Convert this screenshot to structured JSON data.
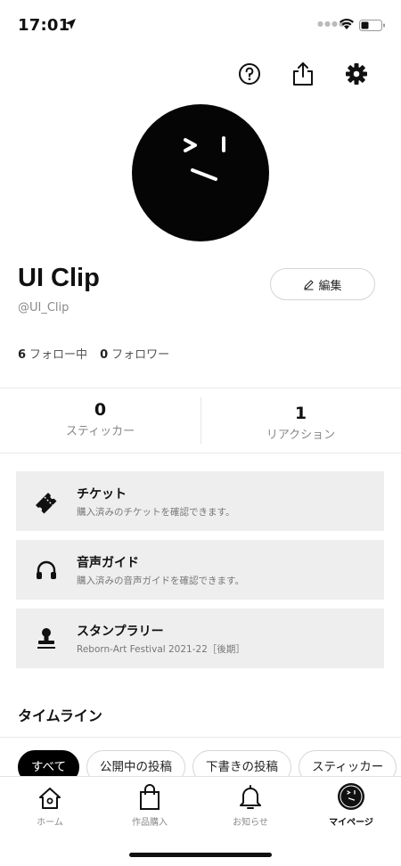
{
  "status_bar": {
    "time": "17:01"
  },
  "header": {
    "help_icon": "help-icon",
    "share_icon": "share-icon",
    "settings_icon": "gear-icon"
  },
  "profile": {
    "name": "UI Clip",
    "handle": "@UI_Clip",
    "edit_label": "編集",
    "following_count": "6",
    "following_label": "フォロー中",
    "followers_count": "0",
    "followers_label": "フォロワー"
  },
  "stats": [
    {
      "value": "0",
      "label": "スティッカー"
    },
    {
      "value": "1",
      "label": "リアクション"
    }
  ],
  "cards": [
    {
      "icon": "ticket-icon",
      "title": "チケット",
      "subtitle": "購入済みのチケットを確認できます。"
    },
    {
      "icon": "headphones-icon",
      "title": "音声ガイド",
      "subtitle": "購入済みの音声ガイドを確認できます。"
    },
    {
      "icon": "stamp-icon",
      "title": "スタンプラリー",
      "subtitle": "Reborn-Art Festival 2021-22［後期］"
    }
  ],
  "timeline": {
    "title": "タイムライン",
    "filters": [
      "すべて",
      "公開中の投稿",
      "下書きの投稿",
      "スティッカー"
    ],
    "active_filter": "すべて"
  },
  "tabs": [
    {
      "icon": "home-icon",
      "label": "ホーム"
    },
    {
      "icon": "shopping-bag-icon",
      "label": "作品購入"
    },
    {
      "icon": "bell-icon",
      "label": "お知らせ"
    },
    {
      "icon": "avatar-icon",
      "label": "マイページ"
    }
  ],
  "colors": {
    "card_bg": "#eeeeee",
    "accent": "#000000"
  }
}
